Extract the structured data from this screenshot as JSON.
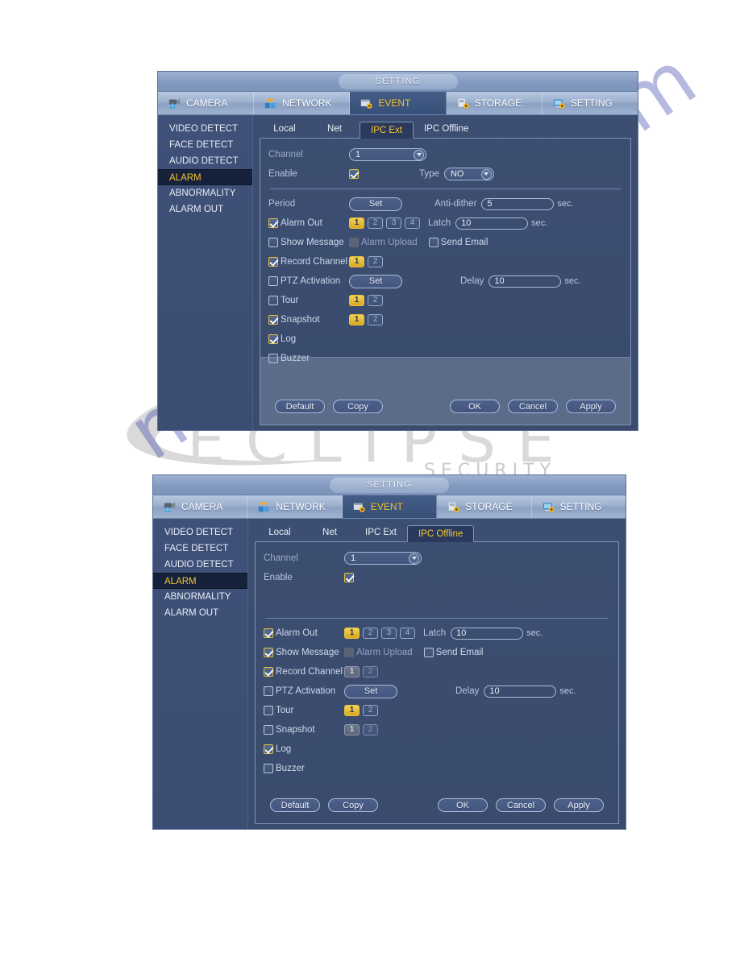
{
  "watermarks": {
    "brand_word": "ECLIPSE",
    "brand_sub": "SECURITY",
    "brand_reg": "®",
    "site": "manualshive.com"
  },
  "window": {
    "title": "SETTING",
    "menu": [
      {
        "label": "CAMERA",
        "icon": "camera-icon",
        "active": false
      },
      {
        "label": "NETWORK",
        "icon": "network-icon",
        "active": false
      },
      {
        "label": "EVENT",
        "icon": "event-icon",
        "active": true
      },
      {
        "label": "STORAGE",
        "icon": "storage-icon",
        "active": false
      },
      {
        "label": "SETTING",
        "icon": "setting-icon",
        "active": false
      }
    ],
    "sidebar": [
      {
        "label": "VIDEO DETECT",
        "active": false
      },
      {
        "label": "FACE DETECT",
        "active": false
      },
      {
        "label": "AUDIO DETECT",
        "active": false
      },
      {
        "label": "ALARM",
        "active": true
      },
      {
        "label": "ABNORMALITY",
        "active": false
      },
      {
        "label": "ALARM OUT",
        "active": false
      }
    ]
  },
  "panel1": {
    "tabs": [
      {
        "label": "Local",
        "active": false
      },
      {
        "label": "Net",
        "active": false
      },
      {
        "label": "IPC Ext",
        "active": true
      },
      {
        "label": "IPC Offline",
        "active": false
      }
    ],
    "channel_label": "Channel",
    "channel_value": "1",
    "enable_label": "Enable",
    "enable_checked": true,
    "type_label": "Type",
    "type_value": "NO",
    "period_label": "Period",
    "period_button": "Set",
    "antidither_label": "Anti-dither",
    "antidither_value": "5",
    "antidither_unit": "sec.",
    "alarm_out_label": "Alarm Out",
    "alarm_out_checked": true,
    "alarm_out_chips": [
      "1",
      "2",
      "3",
      "4"
    ],
    "alarm_out_selected": "1",
    "latch_label": "Latch",
    "latch_value": "10",
    "latch_unit": "sec.",
    "show_message_label": "Show Message",
    "show_message_checked": false,
    "alarm_upload_label": "Alarm Upload",
    "alarm_upload_state": "disabled",
    "send_email_label": "Send Email",
    "send_email_checked": false,
    "record_channel_label": "Record Channel",
    "record_channel_checked": true,
    "record_channel_chips": [
      "1",
      "2"
    ],
    "record_channel_selected": "1",
    "ptz_label": "PTZ Activation",
    "ptz_checked": false,
    "ptz_button": "Set",
    "delay_label": "Delay",
    "delay_value": "10",
    "delay_unit": "sec.",
    "tour_label": "Tour",
    "tour_checked": false,
    "tour_chips": [
      "1",
      "2"
    ],
    "tour_selected": "1",
    "snapshot_label": "Snapshot",
    "snapshot_checked": true,
    "snapshot_chips": [
      "1",
      "2"
    ],
    "snapshot_selected": "1",
    "log_label": "Log",
    "log_checked": true,
    "buzzer_label": "Buzzer",
    "buzzer_checked": false,
    "buttons": {
      "default": "Default",
      "copy": "Copy",
      "ok": "OK",
      "cancel": "Cancel",
      "apply": "Apply"
    }
  },
  "panel2": {
    "tabs": [
      {
        "label": "Local",
        "active": false
      },
      {
        "label": "Net",
        "active": false
      },
      {
        "label": "IPC Ext",
        "active": false
      },
      {
        "label": "IPC Offline",
        "active": true
      }
    ],
    "channel_label": "Channel",
    "channel_value": "1",
    "enable_label": "Enable",
    "enable_checked": true,
    "alarm_out_label": "Alarm Out",
    "alarm_out_checked": true,
    "alarm_out_chips": [
      "1",
      "2",
      "3",
      "4"
    ],
    "alarm_out_selected": "1",
    "latch_label": "Latch",
    "latch_value": "10",
    "latch_unit": "sec.",
    "show_message_label": "Show Message",
    "show_message_checked": true,
    "alarm_upload_label": "Alarm Upload",
    "alarm_upload_state": "disabled",
    "send_email_label": "Send Email",
    "send_email_checked": false,
    "record_channel_label": "Record Channel",
    "record_channel_checked": true,
    "record_channel_chips": [
      "1",
      "2"
    ],
    "record_channel_selected": "1",
    "ptz_label": "PTZ Activation",
    "ptz_checked": false,
    "ptz_button": "Set",
    "delay_label": "Delay",
    "delay_value": "10",
    "delay_unit": "sec.",
    "tour_label": "Tour",
    "tour_checked": false,
    "tour_chips": [
      "1",
      "2"
    ],
    "tour_selected": "1",
    "snapshot_label": "Snapshot",
    "snapshot_checked": false,
    "snapshot_chips": [
      "1",
      "2"
    ],
    "snapshot_selected": "1",
    "log_label": "Log",
    "log_checked": true,
    "buzzer_label": "Buzzer",
    "buzzer_checked": false,
    "buttons": {
      "default": "Default",
      "copy": "Copy",
      "ok": "OK",
      "cancel": "Cancel",
      "apply": "Apply"
    }
  }
}
